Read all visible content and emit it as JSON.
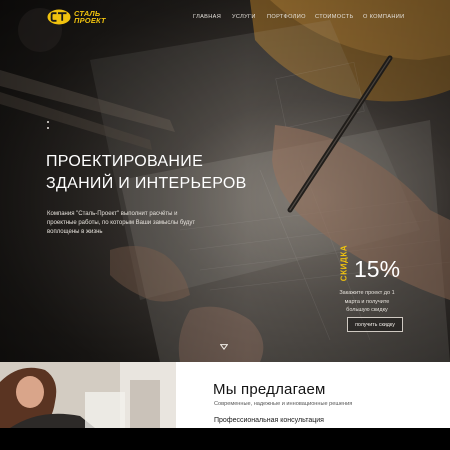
{
  "header": {
    "logo_line1": "Сталь",
    "logo_line2": "Проект",
    "nav": [
      "Главная",
      "Услуги",
      "Портфолио",
      "Стоимость",
      "О компании"
    ]
  },
  "hero": {
    "title_line1": "Проектирование",
    "title_line2": "зданий и интерьеров",
    "lead": "Компания \"Сталь-Проект\" выполнит расчёты и проектные работы, по которым Ваши замыслы будут воплощены в жизнь"
  },
  "promo": {
    "badge": "Скидка",
    "percent": "15%",
    "note": "Закажите проект до 1 марта и получите большую скидку",
    "button": "получить скидку"
  },
  "offer": {
    "title": "Мы предлагаем",
    "subtitle": "Современные, надежные и инновационные решения",
    "first_item": "Профессиональная консультация"
  },
  "colors": {
    "accent": "#f0c20e",
    "hero_text": "#ffffff",
    "offer_bg": "#ffffff"
  },
  "icons": {
    "logo": "logo-mark-icon",
    "scroll": "chevron-down-icon"
  }
}
